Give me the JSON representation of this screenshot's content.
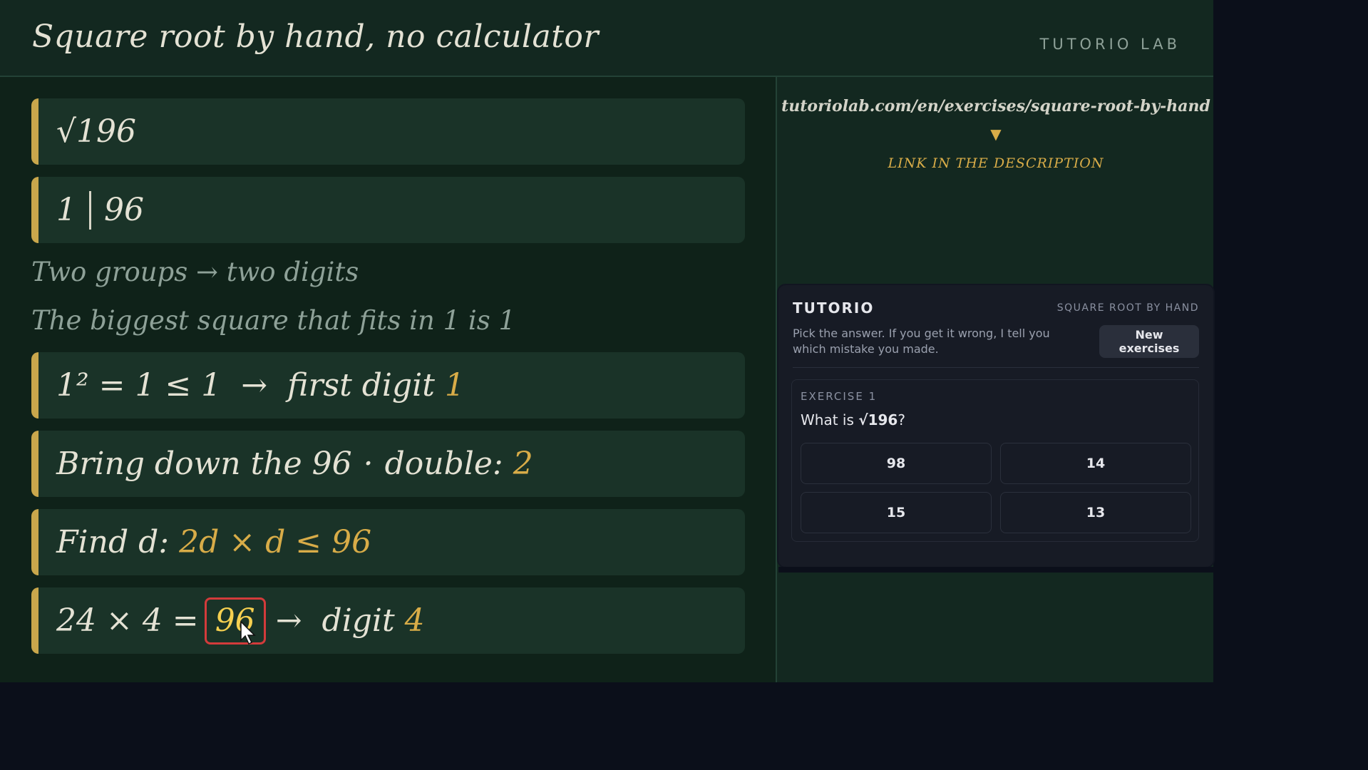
{
  "header": {
    "title": "Square root by hand, no calculator",
    "brand": "TUTORIO LAB"
  },
  "steps": {
    "radical": "√196",
    "groups_left": "1",
    "groups_right": "96",
    "note_groups": "Two groups  →  two digits",
    "note_square": "The biggest square that fits in 1 is 1",
    "step1_text": "1² = 1 ≤ 1  →  first digit ",
    "step1_digit": "1",
    "step2_text": "Bring down the 96",
    "step2_dot": "·",
    "step2_label": "double: ",
    "step2_value": "2",
    "step3_text": "Find d: ",
    "step3_formula": "2d × d ≤ 96",
    "step4_text": "24 × 4 =",
    "step4_highlight": "96",
    "step4_arrow": "→  digit ",
    "step4_digit": "4"
  },
  "promo": {
    "url": "tutoriolab.com/en/exercises/square-root-by-hand",
    "arrow": "▼",
    "link_text": "LINK IN THE DESCRIPTION"
  },
  "widget": {
    "brand": "TUTORIO",
    "topic": "SQUARE ROOT BY HAND",
    "description": "Pick the answer. If you get it wrong, I tell you which mistake you made.",
    "new_button": "New exercises",
    "exercise_label": "EXERCISE 1",
    "question_prefix": "What is ",
    "question_expr": "√196",
    "question_suffix": "?",
    "options": [
      "98",
      "14",
      "15",
      "13"
    ]
  },
  "colors": {
    "board": "#132820",
    "accent_gold": "#d8ac48",
    "highlight_border": "#d33b3b"
  }
}
